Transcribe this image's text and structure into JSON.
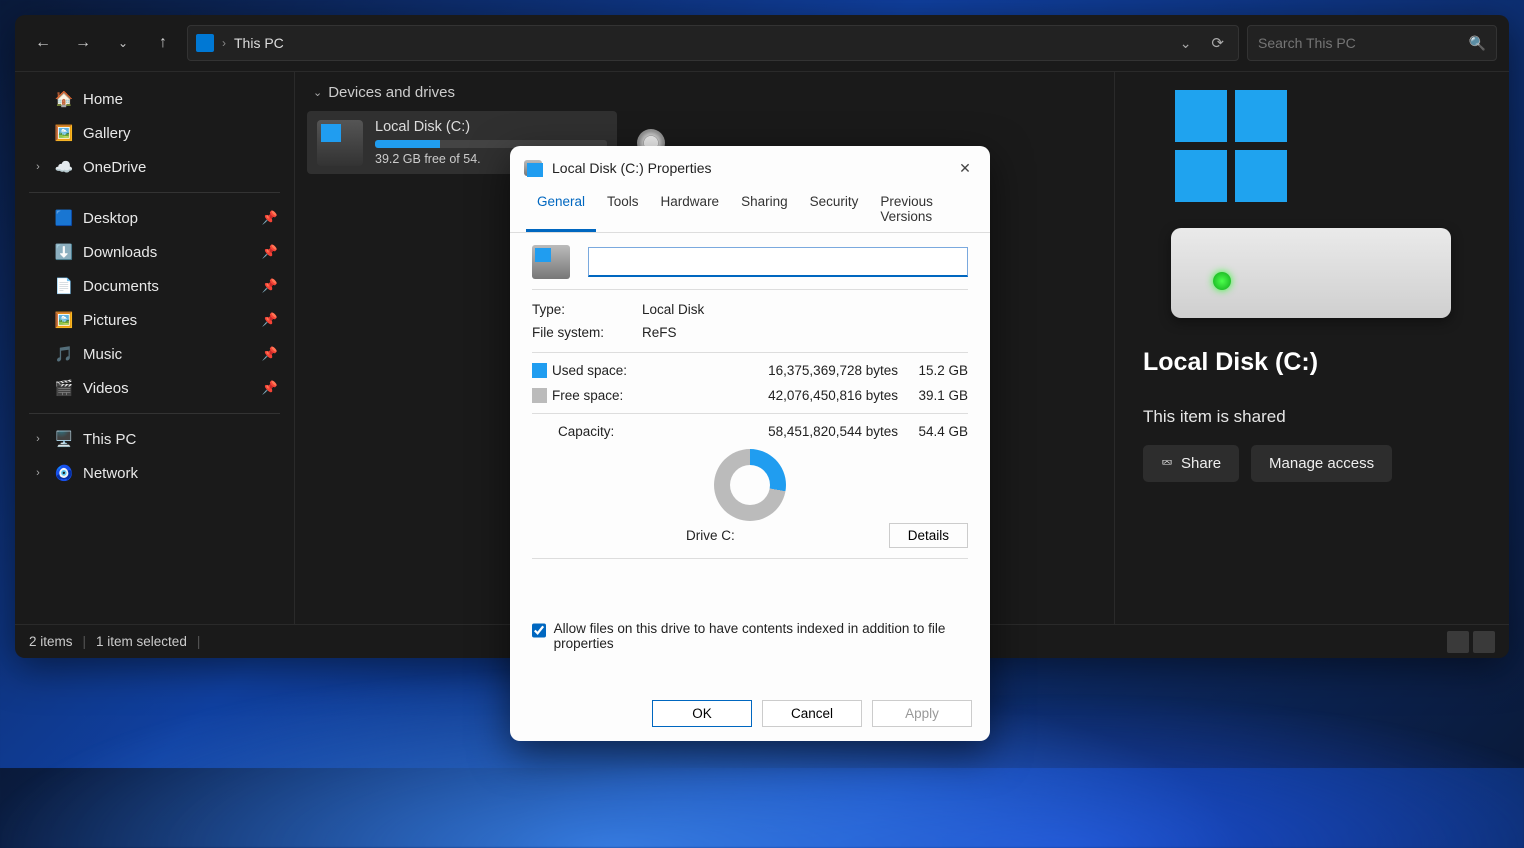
{
  "nav": {
    "breadcrumb": "This PC",
    "search_placeholder": "Search This PC"
  },
  "sidebar": {
    "top": [
      {
        "label": "Home",
        "icon": "🏠"
      },
      {
        "label": "Gallery",
        "icon": "🖼️"
      },
      {
        "label": "OneDrive",
        "icon": "☁️",
        "expandable": true
      }
    ],
    "pinned": [
      {
        "label": "Desktop",
        "icon": "🟦"
      },
      {
        "label": "Downloads",
        "icon": "⬇️"
      },
      {
        "label": "Documents",
        "icon": "📄"
      },
      {
        "label": "Pictures",
        "icon": "🖼️"
      },
      {
        "label": "Music",
        "icon": "🎵"
      },
      {
        "label": "Videos",
        "icon": "🎬"
      }
    ],
    "bottom": [
      {
        "label": "This PC",
        "icon": "🖥️"
      },
      {
        "label": "Network",
        "icon": "🧿"
      }
    ]
  },
  "groups": {
    "devices_label": "Devices and drives"
  },
  "drive_tile": {
    "name": "Local Disk (C:)",
    "free": "39.2 GB free of 54."
  },
  "dvd_hint": "DVD",
  "details": {
    "title": "Local Disk (C:)",
    "shared": "This item is shared",
    "share": "Share",
    "manage": "Manage access"
  },
  "status": {
    "items": "2 items",
    "selected": "1 item selected"
  },
  "dialog": {
    "title": "Local Disk (C:) Properties",
    "tabs": [
      "General",
      "Tools",
      "Hardware",
      "Sharing",
      "Security",
      "Previous Versions"
    ],
    "type_label": "Type:",
    "type_val": "Local Disk",
    "fs_label": "File system:",
    "fs_val": "ReFS",
    "used_label": "Used space:",
    "used_bytes": "16,375,369,728 bytes",
    "used_gb": "15.2 GB",
    "free_label": "Free space:",
    "free_bytes": "42,076,450,816 bytes",
    "free_gb": "39.1 GB",
    "cap_label": "Capacity:",
    "cap_bytes": "58,451,820,544 bytes",
    "cap_gb": "54.4 GB",
    "drive_label": "Drive C:",
    "details_btn": "Details",
    "index_chk": "Allow files on this drive to have contents indexed in addition to file properties",
    "ok": "OK",
    "cancel": "Cancel",
    "apply": "Apply"
  }
}
